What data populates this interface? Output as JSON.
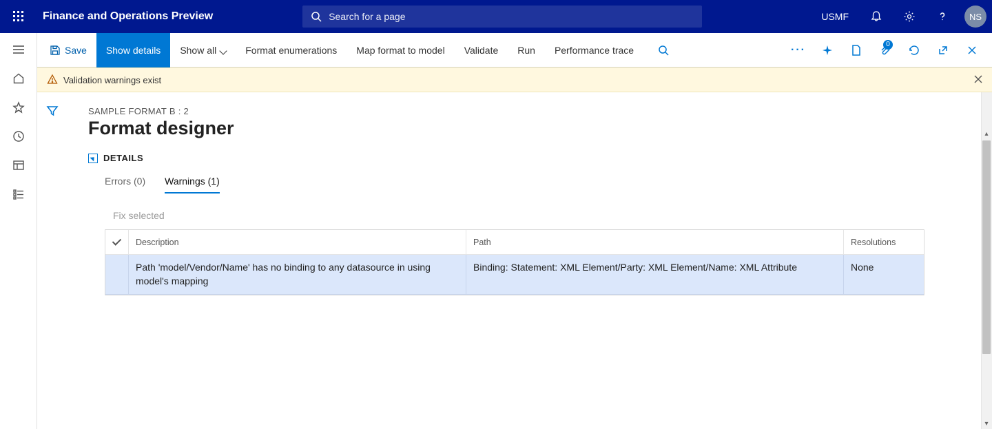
{
  "header": {
    "app_title": "Finance and Operations Preview",
    "search_placeholder": "Search for a page",
    "company": "USMF",
    "avatar_initials": "NS"
  },
  "action_bar": {
    "save": "Save",
    "show_details": "Show details",
    "show_all": "Show all",
    "format_enum": "Format enumerations",
    "map_format": "Map format to model",
    "validate": "Validate",
    "run": "Run",
    "perf_trace": "Performance trace",
    "badge_count": "0"
  },
  "banner": {
    "text": "Validation warnings exist"
  },
  "page": {
    "breadcrumb": "SAMPLE FORMAT B : 2",
    "title": "Format designer",
    "details_label": "DETAILS"
  },
  "tabs": {
    "errors": "Errors (0)",
    "warnings": "Warnings (1)"
  },
  "toolbar": {
    "fix_selected": "Fix selected"
  },
  "table": {
    "headers": {
      "description": "Description",
      "path": "Path",
      "resolutions": "Resolutions"
    },
    "rows": [
      {
        "description": "Path 'model/Vendor/Name' has no binding to any datasource in using model's mapping",
        "path": "Binding: Statement: XML Element/Party: XML Element/Name: XML Attribute",
        "resolutions": "None"
      }
    ]
  }
}
